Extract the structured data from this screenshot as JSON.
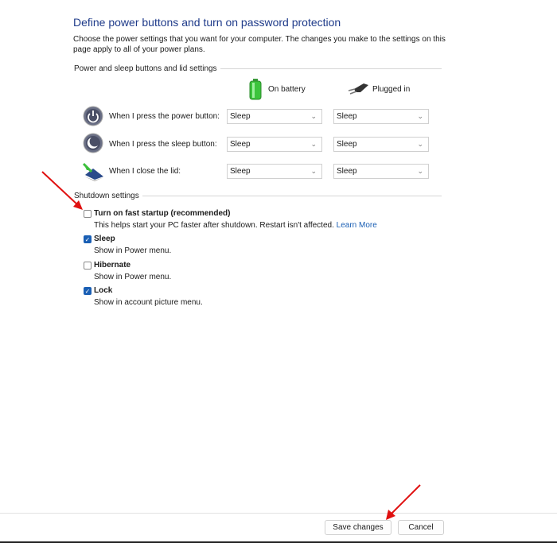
{
  "title": "Define power buttons and turn on password protection",
  "description": "Choose the power settings that you want for your computer. The changes you make to the settings on this page apply to all of your power plans.",
  "power_group": {
    "label": "Power and sleep buttons and lid settings",
    "columns": [
      "On battery",
      "Plugged in"
    ],
    "rows": [
      {
        "label": "When I press the power button:",
        "icon": "power-button-icon",
        "battery": "Sleep",
        "plugged": "Sleep"
      },
      {
        "label": "When I press the sleep button:",
        "icon": "sleep-button-icon",
        "battery": "Sleep",
        "plugged": "Sleep"
      },
      {
        "label": "When I close the lid:",
        "icon": "laptop-lid-icon",
        "battery": "Sleep",
        "plugged": "Sleep"
      }
    ]
  },
  "shutdown": {
    "label": "Shutdown settings",
    "items": [
      {
        "label": "Turn on fast startup (recommended)",
        "desc": "This helps start your PC faster after shutdown. Restart isn't affected.",
        "link": "Learn More",
        "checked": false
      },
      {
        "label": "Sleep",
        "desc": "Show in Power menu.",
        "checked": true
      },
      {
        "label": "Hibernate",
        "desc": "Show in Power menu.",
        "checked": false
      },
      {
        "label": "Lock",
        "desc": "Show in account picture menu.",
        "checked": true
      }
    ]
  },
  "buttons": {
    "save": "Save changes",
    "cancel": "Cancel"
  },
  "colors": {
    "title": "#1f3b8a",
    "checkbox": "#1a5fb4",
    "arrow": "#e01010"
  }
}
